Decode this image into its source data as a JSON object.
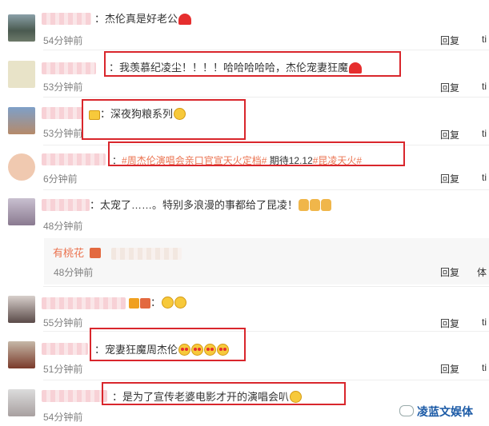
{
  "comments": [
    {
      "text": "杰伦真是好老公",
      "time": "54分钟前",
      "reply": "回复",
      "more": "ti"
    },
    {
      "text": "我羡慕纪凌尘！！！！哈哈哈哈哈，杰伦宠妻狂魔",
      "time": "53分钟前",
      "reply": "回复",
      "more": "ti"
    },
    {
      "text": "深夜狗粮系列",
      "time": "53分钟前",
      "reply": "回复",
      "more": "ti"
    },
    {
      "text_parts": [
        "#周杰伦演唱会亲口官宣天火定档#",
        "期待12.12",
        "#昆凌天火#"
      ],
      "time": "6分钟前",
      "reply": "回复",
      "more": "ti"
    },
    {
      "text": "太宠了……。特别多浪漫的事都给了昆凌！",
      "time": "48分钟前",
      "reply": "",
      "more": ""
    },
    {
      "text": "",
      "time": "55分钟前",
      "reply": "回复",
      "more": "ti"
    },
    {
      "text": "宠妻狂魔周杰伦",
      "time": "51分钟前",
      "reply": "回复",
      "more": "ti"
    },
    {
      "text": "是为了宣传老婆电影才开的演唱会叭",
      "time": "54分钟前",
      "reply": "",
      "more": ""
    }
  ],
  "subreply": {
    "name": "有桃花",
    "time": "48分钟前",
    "reply": "回复",
    "more": "体"
  },
  "watermark": "凌蓝文娱体"
}
